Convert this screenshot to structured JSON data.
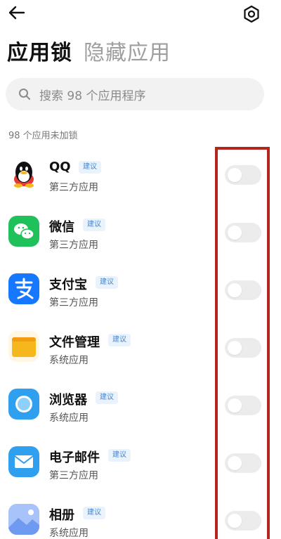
{
  "header": {
    "back_icon": "arrow-left-icon",
    "settings_icon": "gear-icon",
    "tabs": [
      {
        "label": "应用锁",
        "active": true
      },
      {
        "label": "隐藏应用",
        "active": false
      }
    ]
  },
  "search": {
    "icon": "search-icon",
    "placeholder": "搜索 98 个应用程序"
  },
  "section": {
    "label": "98 个应用未加锁"
  },
  "apps": [
    {
      "name": "QQ",
      "tag": "建议",
      "type": "第三方应用",
      "icon": "qq-icon",
      "locked": false
    },
    {
      "name": "微信",
      "tag": "建议",
      "type": "第三方应用",
      "icon": "wechat-icon",
      "locked": false
    },
    {
      "name": "支付宝",
      "tag": "建议",
      "type": "第三方应用",
      "icon": "alipay-icon",
      "locked": false
    },
    {
      "name": "文件管理",
      "tag": "建议",
      "type": "系统应用",
      "icon": "folder-icon",
      "locked": false
    },
    {
      "name": "浏览器",
      "tag": "建议",
      "type": "系统应用",
      "icon": "browser-icon",
      "locked": false
    },
    {
      "name": "电子邮件",
      "tag": "建议",
      "type": "第三方应用",
      "icon": "mail-icon",
      "locked": false
    },
    {
      "name": "相册",
      "tag": "建议",
      "type": "系统应用",
      "icon": "gallery-icon",
      "locked": false
    }
  ],
  "colors": {
    "tag_text": "#4b86c9",
    "tag_bg": "#eaf2fb",
    "toggle_off": "#ececec",
    "highlight_border": "#b3261e",
    "wechat_green": "#1fc15a",
    "alipay_blue": "#1677ff",
    "folder_yellow": "#f6b71c",
    "browser_blue": "#2f9ff0",
    "mail_blue": "#2f9ff0"
  }
}
